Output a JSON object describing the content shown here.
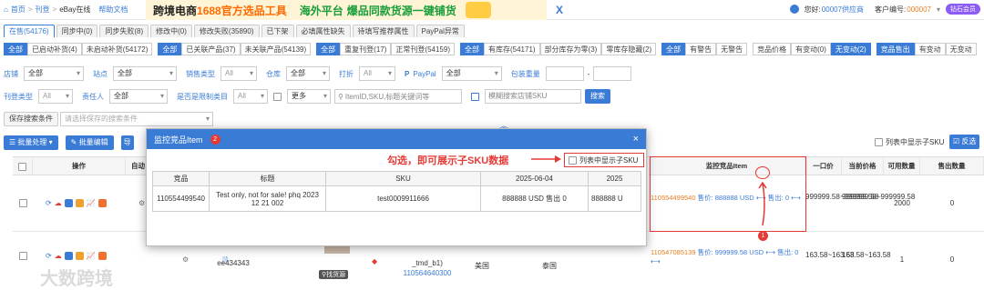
{
  "topbar": {
    "home": "首页",
    "crumb1": "刊登",
    "crumb2": "eBay在线",
    "help": "帮助文档"
  },
  "banner": {
    "part1": "跨境电商",
    "part2": "1688官方选品工具",
    "part3": "海外平台",
    "part4": "爆品同款货源一键铺货",
    "close": "X"
  },
  "user": {
    "greeting": "您好:",
    "uid": "00007供应商",
    "client_label": "客户编号:",
    "client_id": "000007",
    "vip": "钻石会员"
  },
  "tabs": [
    {
      "label": "在售(54176)",
      "active": true
    },
    {
      "label": "同步中(0)",
      "active": false
    },
    {
      "label": "同步失败(8)",
      "active": false
    },
    {
      "label": "修改中(0)",
      "active": false
    },
    {
      "label": "修改失败(35890)",
      "active": false
    },
    {
      "label": "已下架",
      "active": false
    },
    {
      "label": "必填属性缺失",
      "active": false
    },
    {
      "label": "待填写推荐属性",
      "active": false
    },
    {
      "label": "PayPal异常",
      "active": false
    }
  ],
  "filters_row1": [
    {
      "items": [
        {
          "label": "全部",
          "on": true
        },
        {
          "label": "已启动补货(4)"
        },
        {
          "label": "未启动补货(54172)"
        }
      ]
    },
    {
      "items": [
        {
          "label": "全部",
          "on": true
        },
        {
          "label": "已关联产品(37)"
        },
        {
          "label": "未关联产品(54139)"
        }
      ]
    },
    {
      "items": [
        {
          "label": "全部",
          "on": true
        },
        {
          "label": "重复刊登(17)"
        },
        {
          "label": "正常刊登(54159)"
        }
      ]
    },
    {
      "items": [
        {
          "label": "全部",
          "on": true
        },
        {
          "label": "有库存(54171)"
        },
        {
          "label": "部分库存为零(3)"
        },
        {
          "label": "零库存隐藏(2)"
        }
      ]
    },
    {
      "items": [
        {
          "label": "全部",
          "on": true
        },
        {
          "label": "有警告"
        },
        {
          "label": "无警告"
        }
      ]
    },
    {
      "items": [
        {
          "label": "竞品价格"
        },
        {
          "label": "有变动(0)"
        },
        {
          "label": "无变动(2)",
          "on": true
        }
      ]
    },
    {
      "items": [
        {
          "label": "竞品售出",
          "on": true
        },
        {
          "label": "有变动"
        },
        {
          "label": "无变动"
        }
      ]
    }
  ],
  "filters_row2": {
    "store_label": "店铺",
    "store_value": "全部",
    "site_label": "站点",
    "site_value": "全部",
    "saletype_label": "销售类型",
    "saletype_value": "All",
    "warehouse_label": "仓库",
    "warehouse_value": "全部",
    "print_label": "打折",
    "print_value": "All",
    "paypal_label": "PayPal",
    "paypal_value": "全部",
    "weight_label": "包装重量",
    "dash": "-"
  },
  "filters_row3": {
    "listtype_label": "刊登类型",
    "listtype_value": "All",
    "owner_label": "责任人",
    "owner_value": "全部",
    "limitcat_label": "是否是限制类目",
    "limitcat_value": "All",
    "more_label": "更多",
    "search_placeholder": "ItemID,SKU,标题关键词等",
    "fuzzy_placeholder": "模糊搜索店铺SKU",
    "search_btn": "搜索"
  },
  "saved": {
    "label": "保存搜索条件",
    "placeholder": "请选择保存的搜索条件"
  },
  "actions": {
    "batch_process": "批量处理",
    "batch_edit": "批量编辑",
    "other": "导",
    "show_sub_sku": "列表中显示子SKU",
    "reverse": "反选"
  },
  "table": {
    "headers": {
      "op": "操作",
      "auto": "自动",
      "monitor": "监控竞品Item",
      "price": "一口价",
      "current": "当前价格",
      "stock": "可用数量",
      "sold": "售出数量"
    },
    "row1": {
      "monitor_item": "110554499540",
      "monitor_price": "售价: 888888 USD",
      "monitor_sold": "售出: 0",
      "price": "999999.58~999999.58",
      "current": "999999.58~999999.58",
      "stock": "2000",
      "sold": "0"
    },
    "row2": {
      "sku": "ee434343",
      "sub": "_tmd_b1)",
      "item_id": "110564640300",
      "country1": "美国",
      "country2": "泰国",
      "find_source": "找货源",
      "monitor_item": "110547085139",
      "monitor_price": "售价: 999999.58 USD",
      "monitor_sold": "售出: 0",
      "price": "163.58~163.58",
      "current": "163.58~163.58",
      "stock": "1",
      "sold": "0"
    }
  },
  "modal": {
    "title": "监控竞品Item",
    "badge": "2",
    "close": "×",
    "show_sub_sku": "列表中显示子SKU",
    "columns": [
      "竞品",
      "标题",
      "SKU",
      "2025-06-04",
      "2025"
    ],
    "rows": [
      {
        "item": "110554499540",
        "title": "Test only, not for sale! phq 2023 12 21 002",
        "sku": "test0009911666",
        "d1": "888888 USD 售出 0",
        "d2": "888888 U"
      }
    ]
  },
  "annotation": {
    "text": "勾选，即可展示子SKU数据",
    "badge1": "1"
  },
  "watermark": "大数跨境",
  "colors": {
    "accent": "#3a7bd5",
    "danger": "#e53935",
    "orange": "#e67e22"
  }
}
